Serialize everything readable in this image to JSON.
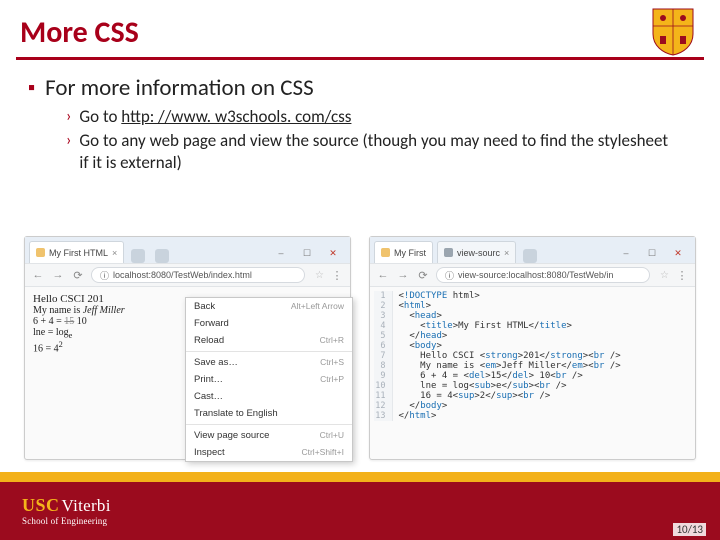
{
  "title": "More CSS",
  "bullets": {
    "lvl1": "For more information on CSS",
    "lvl2a_prefix": "Go to ",
    "lvl2a_link": "http: //www. w3schools. com/css",
    "lvl2b": "Go to any web page and view the source (though you may need to find the stylesheet if it is external)"
  },
  "browser_left": {
    "tab_title": "My First HTML",
    "url": "localhost:8080/TestWeb/index.html",
    "page": {
      "line1": "Hello CSCI 201",
      "line2_prefix": "My name is ",
      "line2_em": "Jeff Miller",
      "line3_html": "6 + 4 = 15 10",
      "line4_html": "lnе = log<sub>e</sub>",
      "line5_html": "16 = 4<sup>2</sup>"
    },
    "context_menu": [
      {
        "label": "Back",
        "shortcut": "Alt+Left Arrow"
      },
      {
        "label": "Forward",
        "shortcut": ""
      },
      {
        "label": "Reload",
        "shortcut": "Ctrl+R"
      },
      {
        "sep": true
      },
      {
        "label": "Save as…",
        "shortcut": "Ctrl+S"
      },
      {
        "label": "Print…",
        "shortcut": "Ctrl+P"
      },
      {
        "label": "Cast…",
        "shortcut": ""
      },
      {
        "label": "Translate to English",
        "shortcut": ""
      },
      {
        "sep": true
      },
      {
        "label": "View page source",
        "shortcut": "Ctrl+U"
      },
      {
        "label": "Inspect",
        "shortcut": "Ctrl+Shift+I"
      }
    ]
  },
  "browser_right": {
    "tab1_title": "My First ",
    "tab2_title": "view-sourc",
    "url": "view-source:localhost:8080/TestWeb/in",
    "source_lines": [
      "<!DOCTYPE html>",
      "<html>",
      "  <head>",
      "    <title>My First HTML</title>",
      "  </head>",
      "  <body>",
      "    Hello CSCI <strong>201</strong><br />",
      "    My name is <em>Jeff Miller</em><br />",
      "    6 + 4 = <del>15</del> 10<br />",
      "    lne = log<sub>e</sub><br />",
      "    16 = 4<sup>2</sup><br />",
      "  </body>",
      "</html>"
    ]
  },
  "footer": {
    "usc": "USC",
    "viterbi": "Viterbi",
    "school": "School of Engineering",
    "page": "10/13"
  }
}
